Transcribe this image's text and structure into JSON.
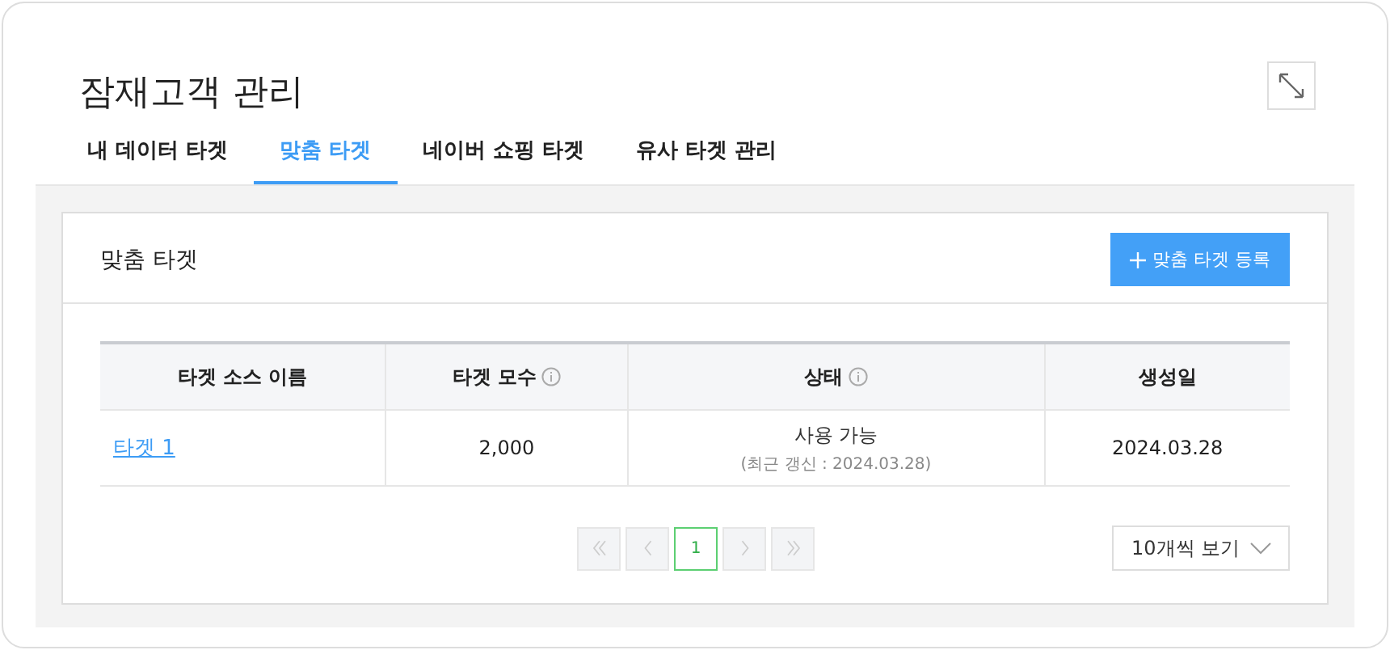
{
  "title": "잠재고객 관리",
  "tabs": [
    {
      "label": "내 데이터 타겟",
      "selected": false
    },
    {
      "label": "맞춤 타겟",
      "selected": true
    },
    {
      "label": "네이버 쇼핑 타겟",
      "selected": false
    },
    {
      "label": "유사 타겟 관리",
      "selected": false
    }
  ],
  "panel": {
    "title": "맞춤 타겟",
    "add_button": "맞춤 타겟 등록"
  },
  "table": {
    "columns": [
      {
        "label": "타겟 소스 이름",
        "info": false
      },
      {
        "label": "타겟 모수",
        "info": true
      },
      {
        "label": "상태",
        "info": true
      },
      {
        "label": "생성일",
        "info": false
      }
    ],
    "rows": [
      {
        "name": "타겟 1",
        "count": "2,000",
        "status": "사용 가능",
        "status_note": "(최근 갱신 : 2024.03.28)",
        "created": "2024.03.28"
      }
    ]
  },
  "pagination": {
    "nav": [
      {
        "kind": "first",
        "disabled": true
      },
      {
        "kind": "prev",
        "disabled": true
      },
      {
        "kind": "next",
        "disabled": true
      },
      {
        "kind": "last",
        "disabled": true
      }
    ],
    "pages": [
      {
        "label": "1",
        "selected": true
      }
    ]
  },
  "page_size": {
    "value": "10개씩 보기"
  }
}
